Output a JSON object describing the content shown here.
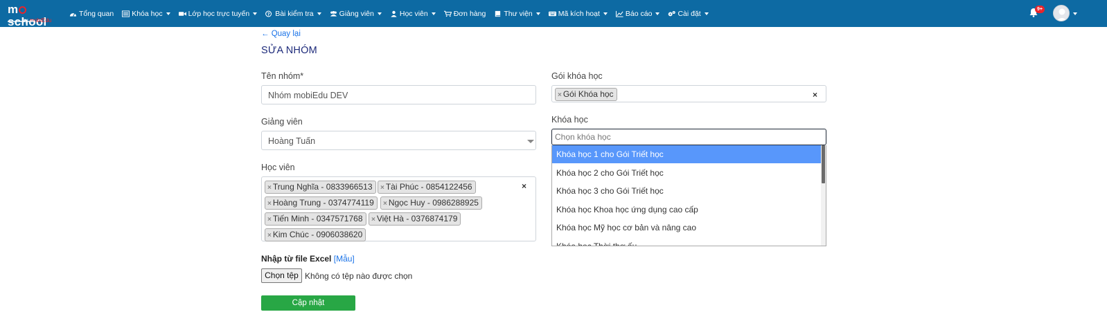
{
  "brand": {
    "name_part1": "m",
    "name_part2": "school",
    "sub_part1": "by ",
    "sub_part2": "mobiEdu"
  },
  "nav": {
    "items": [
      {
        "label": "Tổng quan",
        "icon": "dashboard-icon",
        "has_caret": false
      },
      {
        "label": "Khóa học",
        "icon": "list-icon",
        "has_caret": true
      },
      {
        "label": "Lớp học trực tuyến",
        "icon": "video-icon",
        "has_caret": true
      },
      {
        "label": "Bài kiểm tra",
        "icon": "question-circle-icon",
        "has_caret": true
      },
      {
        "label": "Giảng viên",
        "icon": "users-icon",
        "has_caret": true
      },
      {
        "label": "Học viên",
        "icon": "user-icon",
        "has_caret": true
      },
      {
        "label": "Đơn hàng",
        "icon": "cart-icon",
        "has_caret": false
      },
      {
        "label": "Thư viện",
        "icon": "book-icon",
        "has_caret": true
      },
      {
        "label": "Mã kích hoạt",
        "icon": "keyboard-icon",
        "has_caret": true
      },
      {
        "label": "Báo cáo",
        "icon": "chart-icon",
        "has_caret": true
      },
      {
        "label": "Cài đặt",
        "icon": "gears-icon",
        "has_caret": true
      }
    ],
    "notification_badge": "9+"
  },
  "page": {
    "back_label": "← Quay lại",
    "title": "SỬA NHÓM"
  },
  "form": {
    "group_name": {
      "label": "Tên nhóm*",
      "value": "Nhóm mobiEdu DEV"
    },
    "teacher": {
      "label": "Giảng viên",
      "value": "Hoàng Tuấn"
    },
    "students": {
      "label": "Học viên",
      "tags": [
        "Trung Nghĩa - 0833966513",
        "Tài Phúc - 0854122456",
        "Hoàng Trung - 0374774119",
        "Ngọc Huy - 0986288925",
        "Tiến Minh - 0347571768",
        "Việt Hà - 0376874179",
        "Kim Chúc - 0906038620"
      ]
    },
    "package": {
      "label": "Gói khóa học",
      "tags": [
        "Gói Khóa học"
      ]
    },
    "course": {
      "label": "Khóa học",
      "placeholder": "Chọn khóa học",
      "options": [
        "Khóa học 1 cho Gói Triết học",
        "Khóa học 2 cho Gói Triết học",
        "Khóa học 3 cho Gói Triết học",
        "Khóa học Khoa học ứng dụng cao cấp",
        "Khóa học Mỹ học cơ bản và nâng cao",
        "Khóa học Thời thơ ấu"
      ],
      "active_index": 0
    },
    "excel": {
      "label": "Nhập từ file Excel",
      "bracket_open": "[",
      "sample_link": "Mẫu",
      "bracket_close": "]",
      "file_button": "Chọn tệp",
      "file_status": "Không có tệp nào được chọn"
    },
    "submit_label": "Cập nhật",
    "clear_symbol": "×",
    "tag_remove_symbol": "×"
  },
  "colors": {
    "navbar": "#0d6aa3",
    "accent_link": "#1a73e8",
    "title": "#1d2a7a",
    "submit": "#28a745",
    "dropdown_highlight": "#5897fb",
    "badge": "#e9242b"
  }
}
